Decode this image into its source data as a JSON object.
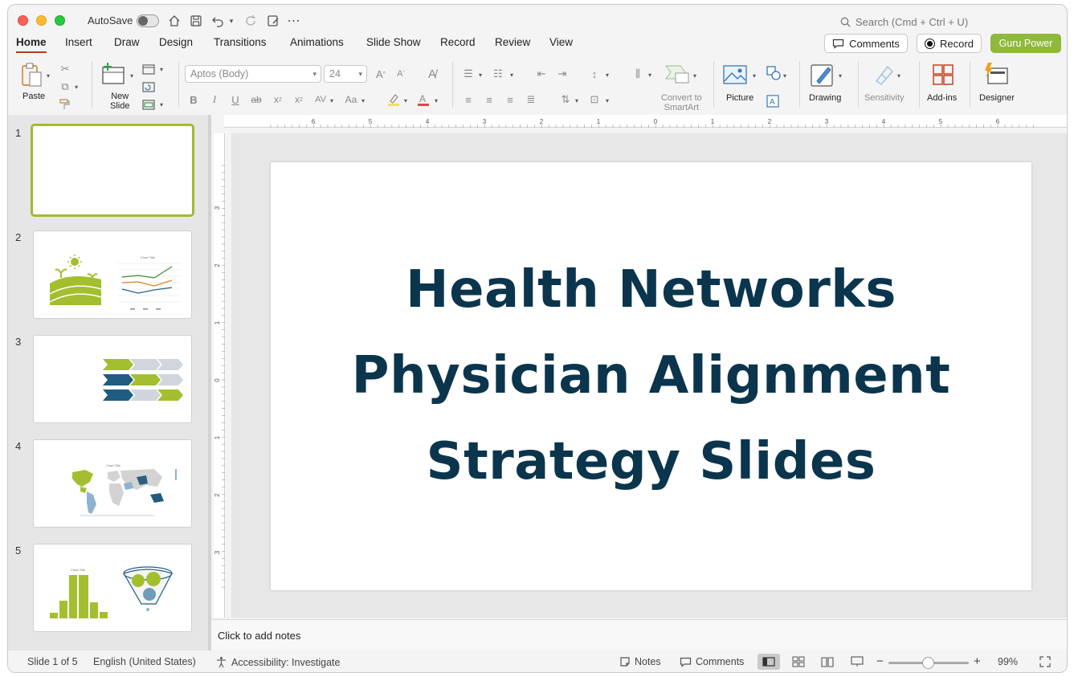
{
  "titlebar": {
    "autosave_label": "AutoSave",
    "search_placeholder": "Search (Cmd + Ctrl + U)"
  },
  "tabs": [
    {
      "label": "Home",
      "active": true
    },
    {
      "label": "Insert"
    },
    {
      "label": "Draw"
    },
    {
      "label": "Design"
    },
    {
      "label": "Transitions"
    },
    {
      "label": "Animations"
    },
    {
      "label": "Slide Show"
    },
    {
      "label": "Record"
    },
    {
      "label": "Review"
    },
    {
      "label": "View"
    }
  ],
  "header_buttons": {
    "comments": "Comments",
    "record": "Record",
    "guru": "Guru Power"
  },
  "ribbon": {
    "paste": "Paste",
    "new_slide_line1": "New",
    "new_slide_line2": "Slide",
    "font_name": "Aptos (Body)",
    "font_size": "24",
    "convert_line1": "Convert to",
    "convert_line2": "SmartArt",
    "picture": "Picture",
    "drawing": "Drawing",
    "sensitivity": "Sensitivity",
    "addins": "Add-ins",
    "designer": "Designer"
  },
  "slides": {
    "numbers": [
      "1",
      "2",
      "3",
      "4",
      "5"
    ],
    "thumb_chart_title": "Chart Title"
  },
  "ruler": {
    "h_labels": [
      "6",
      "5",
      "4",
      "3",
      "2",
      "1",
      "0",
      "1",
      "2",
      "3",
      "4",
      "5",
      "6"
    ],
    "v_labels": [
      "3",
      "2",
      "1",
      "0",
      "1",
      "2",
      "3"
    ]
  },
  "slide": {
    "title_line1": "Health Networks",
    "title_line2": "Physician Alignment",
    "title_line3": "Strategy Slides"
  },
  "notes": {
    "placeholder": "Click to add notes"
  },
  "statusbar": {
    "slide_info": "Slide 1 of 5",
    "language": "English (United States)",
    "accessibility": "Accessibility: Investigate",
    "notes": "Notes",
    "comments": "Comments",
    "zoom": "99%"
  },
  "colors": {
    "accent_tab": "#b8391d",
    "guru_button": "#8fb93a",
    "title_text": "#0b354d",
    "thumb_green": "#a3bf2f",
    "thumb_navy": "#1f5c7f",
    "selected_border": "#a7b832"
  }
}
